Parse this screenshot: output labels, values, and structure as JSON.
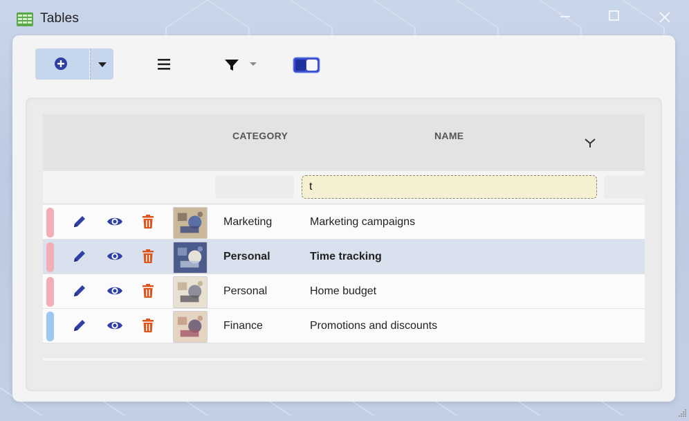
{
  "window": {
    "title": "Tables"
  },
  "toolbar": {
    "add_icon": "plus-circle-icon",
    "menu_icon": "hamburger-icon",
    "filter_icon": "funnel-icon",
    "toggle_state": "on"
  },
  "table": {
    "columns": {
      "category": "CATEGORY",
      "name": "NAME"
    },
    "filter": {
      "category": "",
      "name": "t"
    },
    "rows": [
      {
        "marker": "#f2aeb6",
        "category": "Marketing",
        "name": "Marketing campaigns",
        "selected": false
      },
      {
        "marker": "#f2aeb6",
        "category": "Personal",
        "name": "Time tracking",
        "selected": true
      },
      {
        "marker": "#f2aeb6",
        "category": "Personal",
        "name": "Home budget",
        "selected": false
      },
      {
        "marker": "#9cc7f0",
        "category": "Finance",
        "name": "Promotions and discounts",
        "selected": false
      }
    ]
  },
  "colors": {
    "accent": "#2f3fa3",
    "delete": "#e0531a",
    "toolbar_button": "#c6d6ec",
    "selected_row": "#d9e1ee"
  }
}
